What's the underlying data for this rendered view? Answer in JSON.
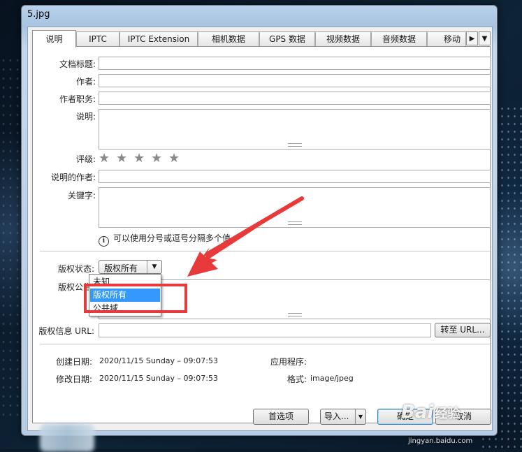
{
  "window": {
    "title": "5.jpg"
  },
  "tabs": {
    "items": [
      "说明",
      "IPTC",
      "IPTC Extension",
      "相机数据",
      "GPS 数据",
      "视频数据",
      "音频数据",
      "移动"
    ],
    "scroll_right": "▶",
    "menu": "▼"
  },
  "fields": {
    "doc_title": "文档标题:",
    "author": "作者:",
    "author_title": "作者职务:",
    "description": "说明:",
    "rating": "评级:",
    "rating_value": 0,
    "rating_max": 5,
    "desc_writer": "说明的作者:",
    "keywords": "关键字:",
    "keywords_hint": "可以使用分号或逗号分隔多个值",
    "info_icon": "i"
  },
  "copyright": {
    "status_label": "版权状态:",
    "status_value": "版权所有",
    "notice_label": "版权公告:",
    "options": [
      "未知",
      "版权所有",
      "公共域"
    ],
    "selected_option": "版权所有",
    "url_label": "版权信息 URL:",
    "goto_button": "转至 URL..."
  },
  "meta": {
    "created_label": "创建日期:",
    "created_value": "2020/11/15 Sunday – 09:07:53",
    "modified_label": "修改日期:",
    "modified_value": "2020/11/15 Sunday – 09:07:53",
    "app_label": "应用程序:",
    "app_value": "",
    "format_label": "格式:",
    "format_value": "image/jpeg"
  },
  "buttons": {
    "preferences": "首选项",
    "import": "导入...",
    "ok": "确定",
    "cancel": "取消"
  },
  "watermark": {
    "brand": "Bai",
    "brand2": "经验",
    "url": "jingyan.baidu.com"
  },
  "colors": {
    "highlight": "#3399ff",
    "annotation_red": "#e83a3a"
  }
}
